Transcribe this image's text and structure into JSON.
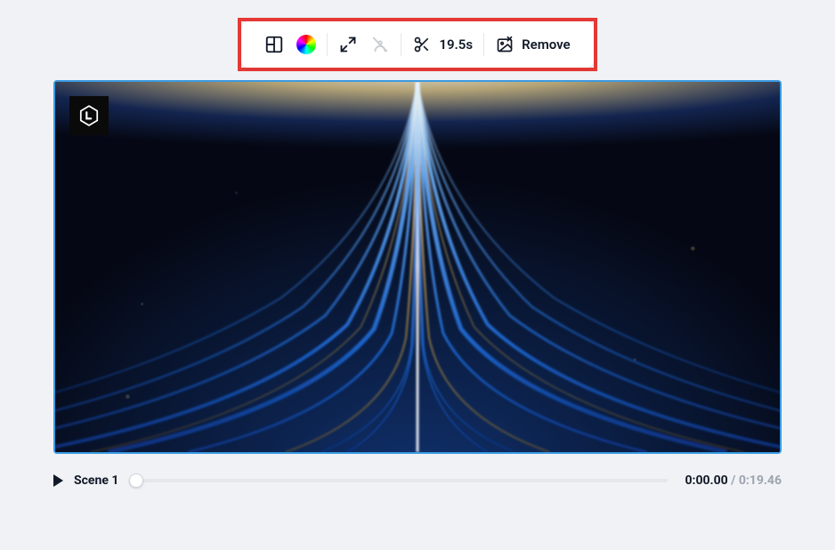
{
  "toolbar": {
    "trim_label": "19.5s",
    "remove_label": "Remove"
  },
  "timeline": {
    "scene_label": "Scene 1",
    "current_time": "0:00.00",
    "separator": " / ",
    "total_time": "0:19.46"
  }
}
